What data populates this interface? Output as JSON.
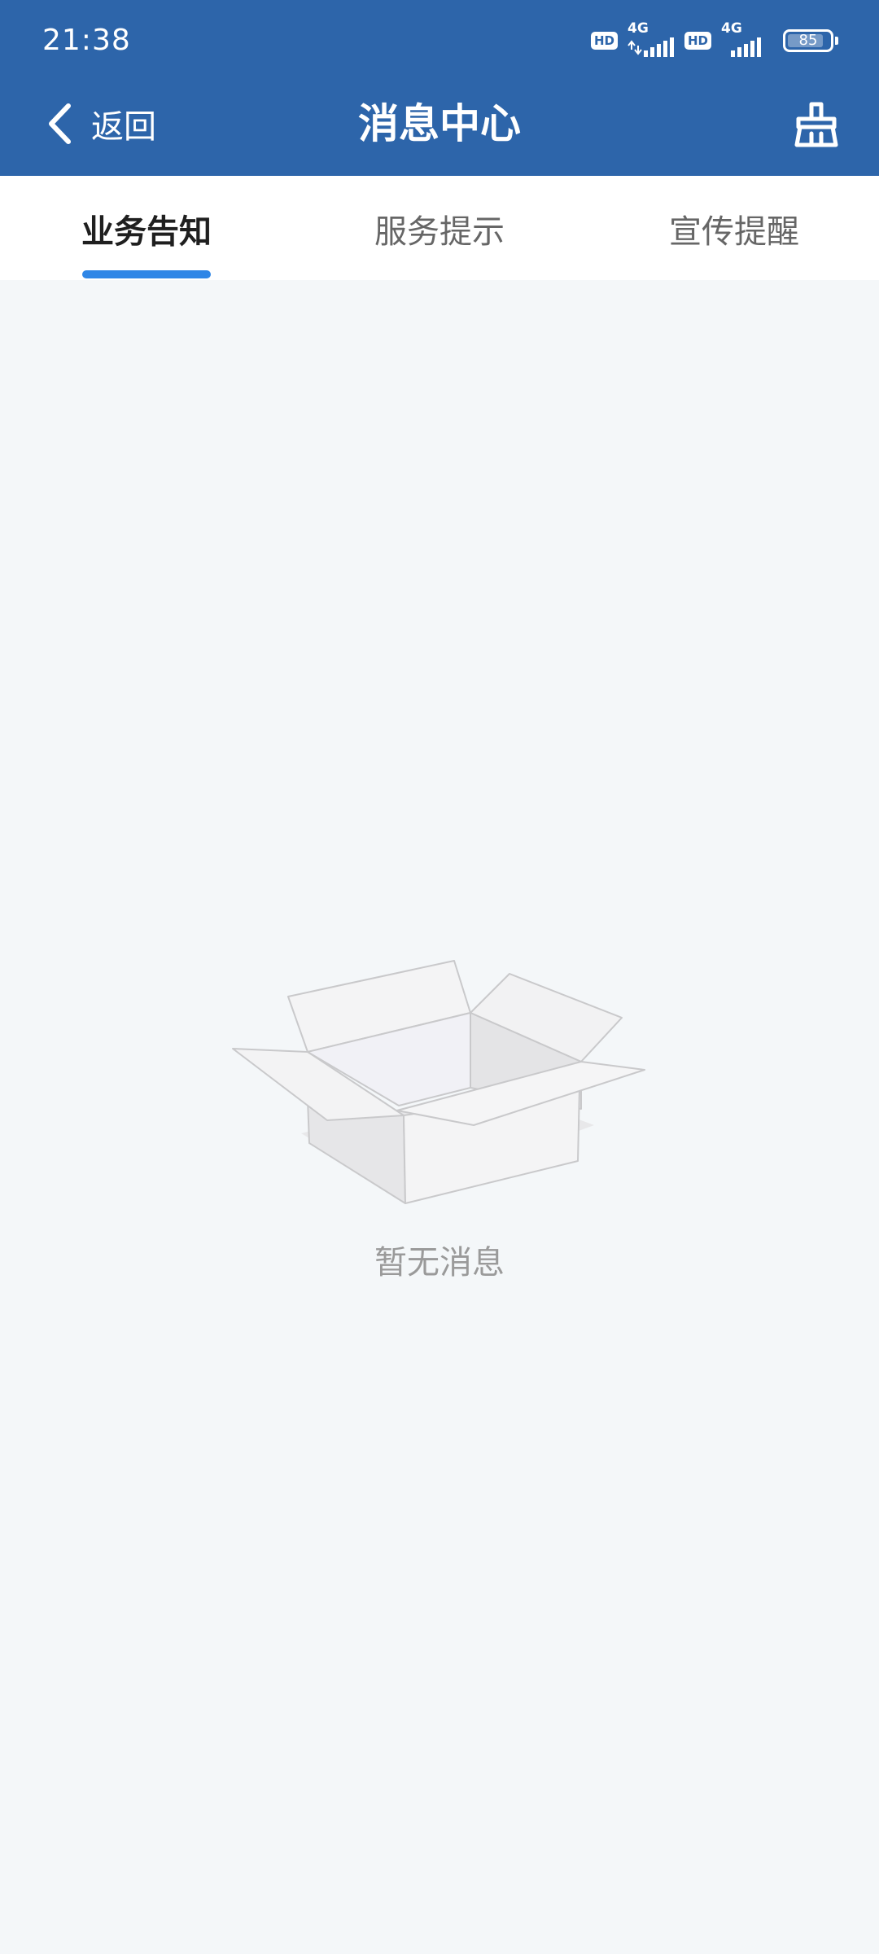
{
  "status_bar": {
    "time": "21:38",
    "sim1_badge": "HD",
    "sim1_network": "4G",
    "sim2_badge": "HD",
    "sim2_network": "4G",
    "battery_level": "85"
  },
  "nav": {
    "back_label": "返回",
    "title": "消息中心",
    "clear_icon": "broom-icon"
  },
  "tabs": [
    {
      "label": "业务告知",
      "active": true
    },
    {
      "label": "服务提示",
      "active": false
    },
    {
      "label": "宣传提醒",
      "active": false
    }
  ],
  "empty_state": {
    "icon": "empty-box-icon",
    "text": "暂无消息"
  },
  "colors": {
    "header_bg": "#2d65aa",
    "tab_indicator": "#2f86e6",
    "page_bg": "#f4f7f9"
  }
}
